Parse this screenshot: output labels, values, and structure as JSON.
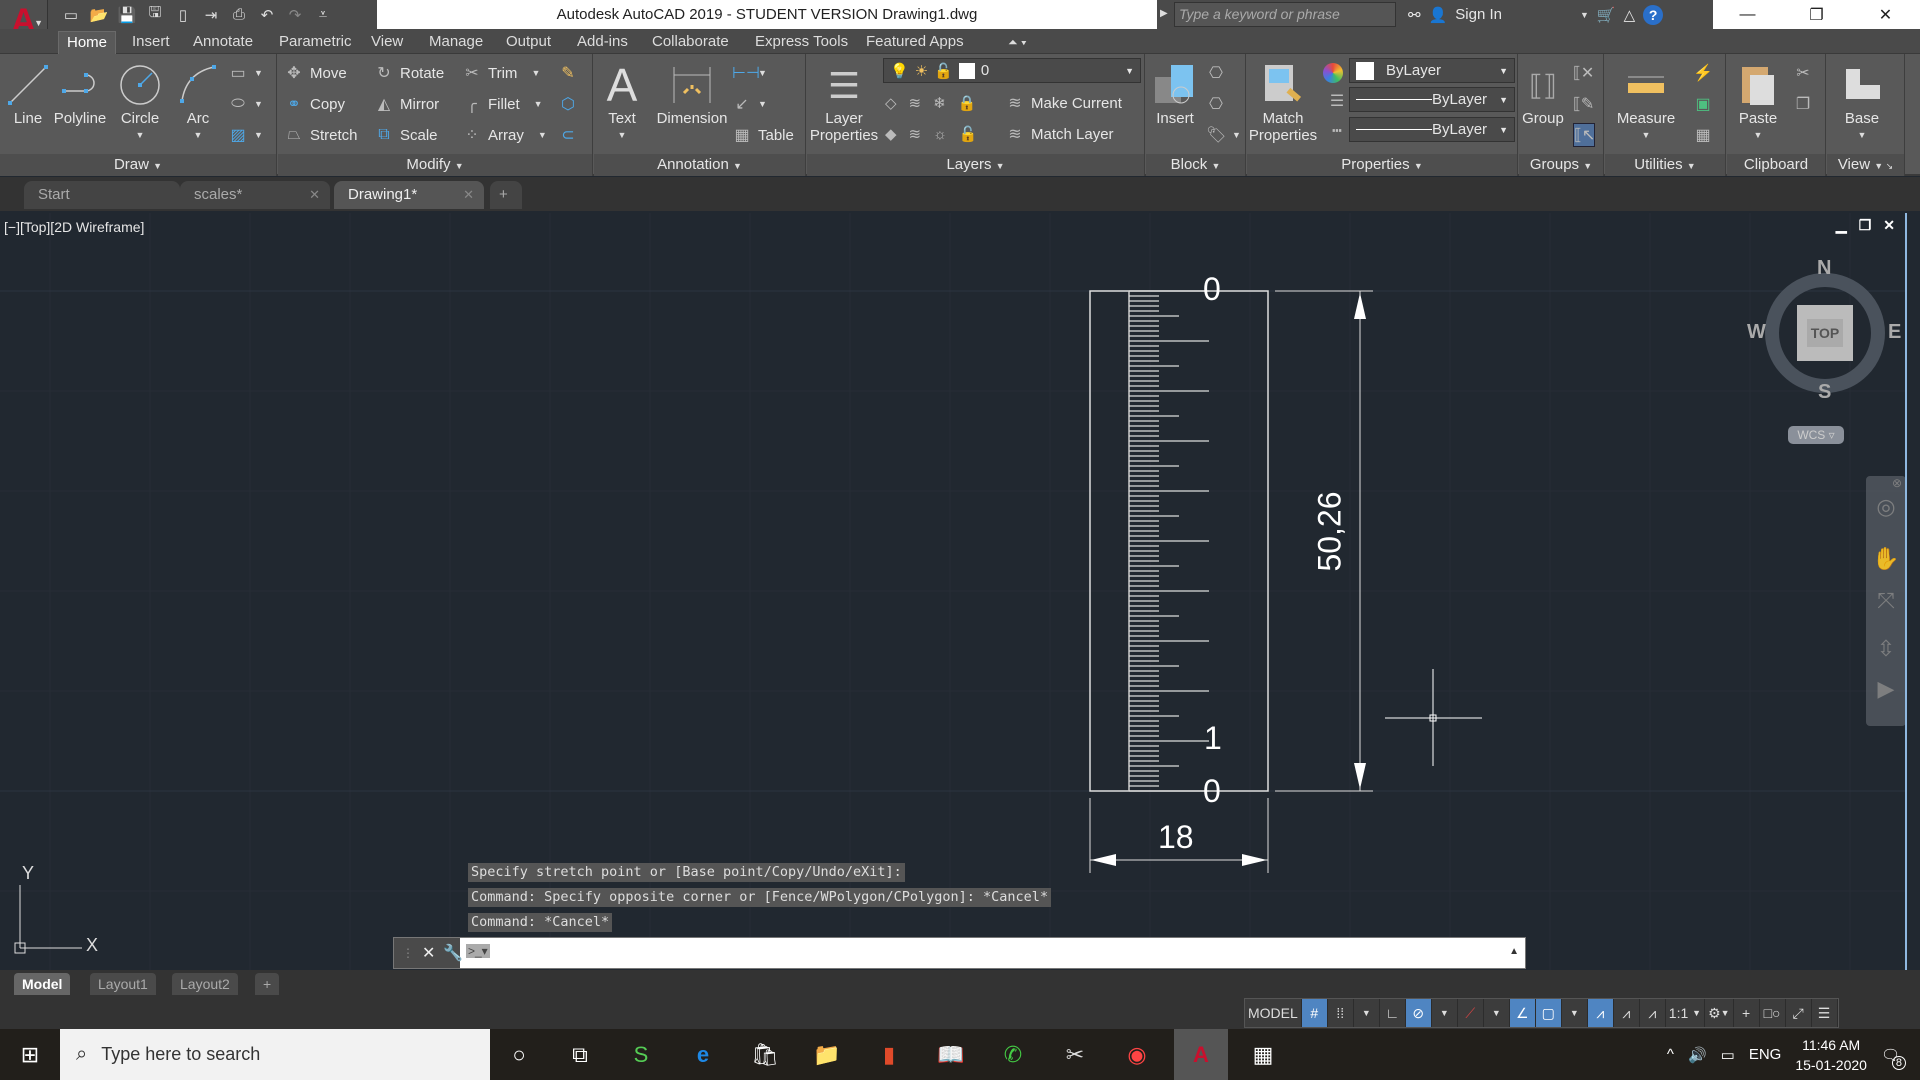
{
  "app": {
    "title": "Autodesk AutoCAD 2019 - STUDENT VERSION    Drawing1.dwg",
    "logo_letter": "A",
    "search_placeholder": "Type a keyword or phrase",
    "sign_in": "Sign In"
  },
  "quick_access": [
    "new-icon",
    "open-icon",
    "save-icon",
    "save-as-icon",
    "open-from-web-icon",
    "save-to-web-icon",
    "plot-icon",
    "undo-icon",
    "redo-icon",
    "customize-icon"
  ],
  "ribbon_tabs": [
    "Home",
    "Insert",
    "Annotate",
    "Parametric",
    "View",
    "Manage",
    "Output",
    "Add-ins",
    "Collaborate",
    "Express Tools",
    "Featured Apps"
  ],
  "active_ribbon_tab": "Home",
  "ribbon": {
    "draw": {
      "label": "Draw",
      "line": "Line",
      "polyline": "Polyline",
      "circle": "Circle",
      "arc": "Arc"
    },
    "modify": {
      "label": "Modify",
      "move": "Move",
      "rotate": "Rotate",
      "trim": "Trim",
      "copy": "Copy",
      "mirror": "Mirror",
      "fillet": "Fillet",
      "stretch": "Stretch",
      "scale": "Scale",
      "array": "Array"
    },
    "annotation": {
      "label": "Annotation",
      "text": "Text",
      "dimension": "Dimension",
      "table": "Table"
    },
    "layers": {
      "label": "Layers",
      "layer_properties_1": "Layer",
      "layer_properties_2": "Properties",
      "current_layer": "0",
      "make_current": "Make Current",
      "match_layer": "Match Layer"
    },
    "block": {
      "label": "Block",
      "insert": "Insert"
    },
    "properties": {
      "label": "Properties",
      "match_1": "Match",
      "match_2": "Properties",
      "color": "ByLayer",
      "lineweight": "ByLayer",
      "linetype": "ByLayer"
    },
    "groups": {
      "label": "Groups",
      "group": "Group"
    },
    "utilities": {
      "label": "Utilities",
      "measure": "Measure"
    },
    "clipboard": {
      "label": "Clipboard",
      "paste": "Paste"
    },
    "view": {
      "label": "View",
      "base": "Base"
    }
  },
  "doc_tabs": [
    {
      "label": "Start",
      "active": false
    },
    {
      "label": "scales*",
      "active": false
    },
    {
      "label": "Drawing1*",
      "active": true
    }
  ],
  "viewport": {
    "label": "[−][Top][2D Wireframe]",
    "compass": {
      "n": "N",
      "s": "S",
      "e": "E",
      "w": "W",
      "face": "TOP",
      "ucs": "WCS"
    }
  },
  "drawing": {
    "top_label": "0",
    "one_label": "1",
    "bottom_label": "0",
    "height_dim": "50,26",
    "width_dim": "18",
    "ucs_x": "X",
    "ucs_y": "Y"
  },
  "command_history": [
    "Specify stretch point or [Base point/Copy/Undo/eXit]:",
    "Command: Specify opposite corner or [Fence/WPolygon/CPolygon]: *Cancel*",
    "Command: *Cancel*"
  ],
  "command_input": "",
  "layout_tabs": [
    {
      "label": "Model",
      "active": true
    },
    {
      "label": "Layout1",
      "active": false
    },
    {
      "label": "Layout2",
      "active": false
    }
  ],
  "status": {
    "model": "MODEL",
    "scale": "1:1"
  },
  "taskbar": {
    "search_placeholder": "Type here to search",
    "language": "ENG",
    "time": "11:46 AM",
    "date": "15-01-2020",
    "notifications": "8"
  }
}
